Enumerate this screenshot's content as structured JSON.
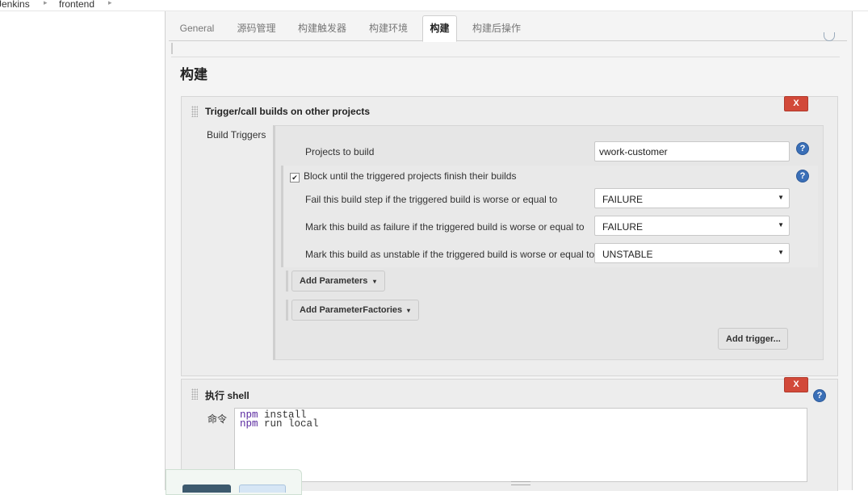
{
  "breadcrumb": {
    "items": [
      "Jenkins",
      "frontend"
    ],
    "separator": "▸"
  },
  "tabs": [
    "General",
    "源码管理",
    "构建触发器",
    "构建环境",
    "构建",
    "构建后操作"
  ],
  "active_tab": "构建",
  "section": {
    "title": "构建",
    "help_icon": "question-circle-icon"
  },
  "trigger_step": {
    "title": "Trigger/call builds on other projects",
    "delete_label": "X",
    "group_label": "Build Triggers",
    "projects_label": "Projects to build",
    "projects_value": "vwork-customer",
    "block_label": "Block until the triggered projects finish their builds",
    "block_checked": true,
    "fail_label": "Fail this build step if the triggered build is worse or equal to",
    "fail_value": "FAILURE",
    "failure_label": "Mark this build as failure if the triggered build is worse or equal to",
    "failure_value": "FAILURE",
    "unstable_label": "Mark this build as unstable if the triggered build is worse or equal to",
    "unstable_value": "UNSTABLE",
    "add_parameters_label": "Add Parameters",
    "add_factories_label": "Add ParameterFactories",
    "add_trigger_label": "Add trigger..."
  },
  "shell_step": {
    "title": "执行 shell",
    "delete_label": "X",
    "command_label": "命令",
    "command_lines": [
      {
        "cmd": "npm",
        "args": " install"
      },
      {
        "cmd": "npm",
        "args": " run local"
      }
    ]
  },
  "icons": {
    "help": "?",
    "checkmark": "✔",
    "dropdown": "▼",
    "caret": "▾"
  },
  "colors": {
    "accent": "#3a6fb7",
    "delete": "#d24939",
    "save": "#3d5a6e"
  }
}
